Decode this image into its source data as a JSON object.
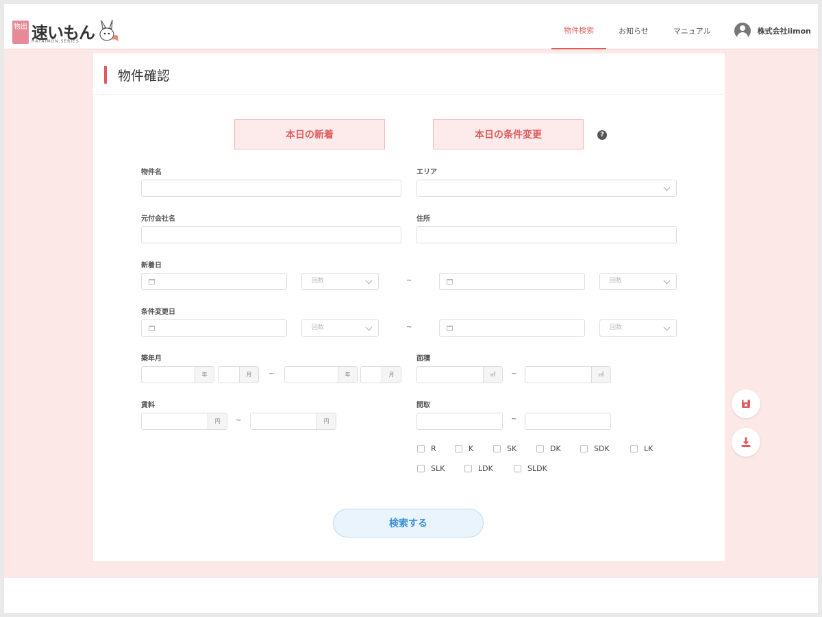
{
  "brand": {
    "logo_box": "物出",
    "logo_text": "速いもん",
    "logo_sub": "HAYAIMON SERIES"
  },
  "nav": {
    "items": [
      "物件検索",
      "お知らせ",
      "マニュアル"
    ],
    "active": "物件検索",
    "user_name": "株式会社iimon"
  },
  "page": {
    "title": "物件確認"
  },
  "quick_buttons": {
    "today_new": "本日の新着",
    "today_changed": "本日の条件変更",
    "help_icon": "?"
  },
  "form": {
    "property_name_label": "物件名",
    "area_label": "エリア",
    "agency_label": "元付会社名",
    "address_label": "住所",
    "new_date_label": "新着日",
    "changed_date_label": "条件変更日",
    "count_placeholder": "回数",
    "built_label": "築年月",
    "area_size_label": "面積",
    "rent_label": "賃料",
    "layout_label": "間取",
    "year_unit": "年",
    "month_unit": "月",
    "sqm_unit": "㎡",
    "yen_unit": "円",
    "range_sep": "~",
    "layouts_row1": [
      "R",
      "K",
      "SK",
      "DK",
      "SDK",
      "LK"
    ],
    "layouts_row2": [
      "SLK",
      "LDK",
      "SLDK"
    ]
  },
  "actions": {
    "search_label": "検索する",
    "save_icon": "save-icon",
    "download_icon": "download-icon"
  },
  "colors": {
    "accent": "#e05c5c",
    "background": "#fde8e8",
    "search": "#3b8fd8"
  }
}
